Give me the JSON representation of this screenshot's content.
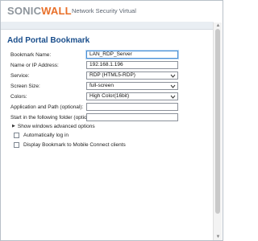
{
  "header": {
    "brand_part1": "SONIC",
    "brand_part2": "WALL",
    "subtitle": "Network Security Virtual"
  },
  "form": {
    "title": "Add Portal Bookmark",
    "fields": [
      {
        "label": "Bookmark Name:",
        "value": "LAN_RDP_Server",
        "type": "text"
      },
      {
        "label": "Name or IP Address:",
        "value": "192.168.1.196",
        "type": "text"
      },
      {
        "label": "Service:",
        "value": "RDP (HTML5-RDP)",
        "type": "select"
      },
      {
        "label": "Screen Size:",
        "value": "full-screen",
        "type": "select"
      },
      {
        "label": "Colors:",
        "value": "High Color(16bit)",
        "type": "select"
      },
      {
        "label": "Application and Path (optional):",
        "value": "",
        "type": "text"
      },
      {
        "label": "Start in the following folder (optional):",
        "value": "",
        "type": "text"
      }
    ],
    "advanced_toggle": "Show windows advanced options",
    "checkboxes": [
      {
        "label": "Automatically log in",
        "checked": false
      },
      {
        "label": "Display Bookmark to Mobile Connect clients",
        "checked": false
      }
    ]
  },
  "colors": {
    "title": "#1b4f8c",
    "accent": "#e8702a",
    "field_border": "#8a9099"
  }
}
